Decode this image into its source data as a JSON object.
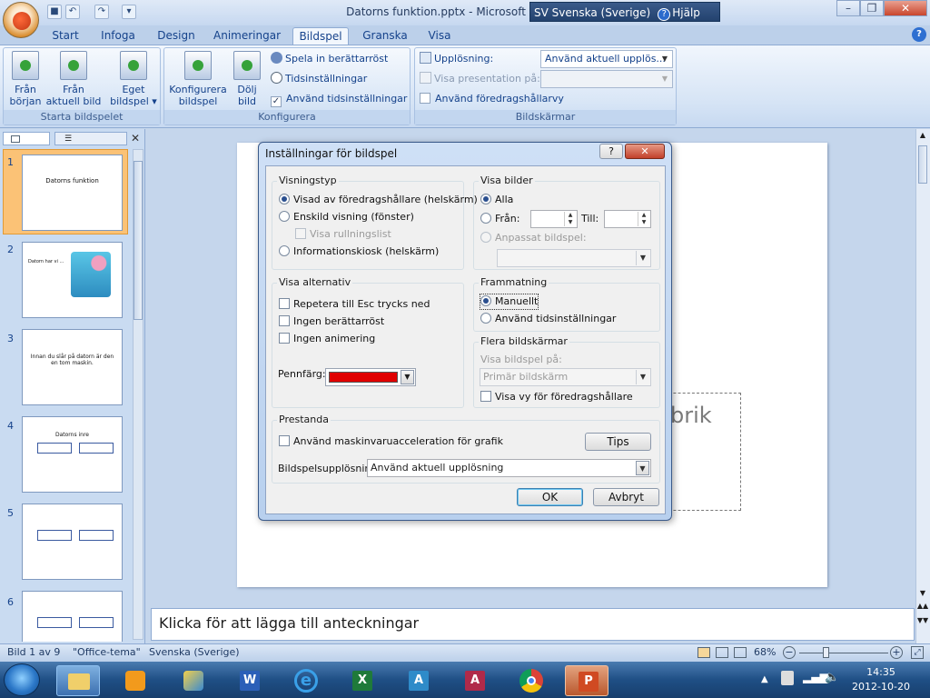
{
  "window": {
    "title": "Datorns funktion.pptx - Microsoft P",
    "language": "SV Svenska (Sverige)",
    "help_label": "Hjälp",
    "controls": [
      "–",
      "❐",
      "✕"
    ]
  },
  "tabs": [
    "Start",
    "Infoga",
    "Design",
    "Animeringar",
    "Bildspel",
    "Granska",
    "Visa"
  ],
  "active_tab": "Bildspel",
  "ribbon": {
    "start_group": {
      "label": "Starta bildspelet",
      "buttons": [
        {
          "line1": "Från",
          "line2": "början"
        },
        {
          "line1": "Från",
          "line2": "aktuell bild"
        },
        {
          "line1": "Eget",
          "line2": "bildspel ▾"
        }
      ]
    },
    "config_group": {
      "label": "Konfigurera",
      "big_buttons": [
        {
          "line1": "Konfigurera",
          "line2": "bildspel"
        },
        {
          "line1": "Dölj",
          "line2": "bild"
        }
      ],
      "record": "Spela in berättarröst",
      "timings": "Tidsinställningar",
      "use_timings": "Använd tidsinställningar"
    },
    "monitors_group": {
      "label": "Bildskärmar",
      "resolution_label": "Upplösning:",
      "resolution_value": "Använd aktuell upplös...",
      "show_on_label": "Visa presentation på:",
      "presenter_view": "Använd föredragshållarvy"
    }
  },
  "slides": [
    {
      "num": "1",
      "text": "Datorns funktion"
    },
    {
      "num": "2",
      "text": "Datorn har vi ..."
    },
    {
      "num": "3",
      "text": "Innan du slår på datorn är den en tom maskin."
    },
    {
      "num": "4",
      "text": "Datorns inre"
    },
    {
      "num": "5",
      "text": ""
    },
    {
      "num": "6",
      "text": ""
    }
  ],
  "slide_placeholder_text": "brik",
  "notes_placeholder": "Klicka för att lägga till anteckningar",
  "status": {
    "slide": "Bild 1 av 9",
    "theme": "\"Office-tema\"",
    "language": "Svenska (Sverige)",
    "zoom": "68%"
  },
  "taskbar": {
    "time": "14:35",
    "date": "2012-10-20"
  },
  "dialog": {
    "title": "Inställningar för bildspel",
    "help": "?",
    "close": "✕",
    "show_type": {
      "legend": "Visningstyp",
      "options": [
        "Visad av föredragshållare (helskärm)",
        "Enskild visning (fönster)",
        "Informationskiosk (helskärm)"
      ],
      "scrollbar": "Visa rullningslist"
    },
    "show_slides": {
      "legend": "Visa bilder",
      "all": "Alla",
      "from": "Från:",
      "to": "Till:",
      "custom": "Anpassat bildspel:"
    },
    "show_options": {
      "legend": "Visa alternativ",
      "loop": "Repetera till Esc trycks ned",
      "no_narration": "Ingen berättarröst",
      "no_animation": "Ingen animering",
      "pen_color": "Pennfärg:",
      "pen_color_value": "#e00000"
    },
    "advance": {
      "legend": "Frammatning",
      "manual": "Manuellt",
      "timings": "Använd tidsinställningar"
    },
    "multi_monitor": {
      "legend": "Flera bildskärmar",
      "show_on": "Visa bildspel på:",
      "value": "Primär bildskärm",
      "presenter_view": "Visa vy för föredragshållare"
    },
    "performance": {
      "legend": "Prestanda",
      "hw_accel": "Använd maskinvaruacceleration för grafik",
      "tips": "Tips",
      "resolution_label": "Bildspelsupplösning:",
      "resolution_value": "Använd aktuell upplösning"
    },
    "ok": "OK",
    "cancel": "Avbryt"
  }
}
